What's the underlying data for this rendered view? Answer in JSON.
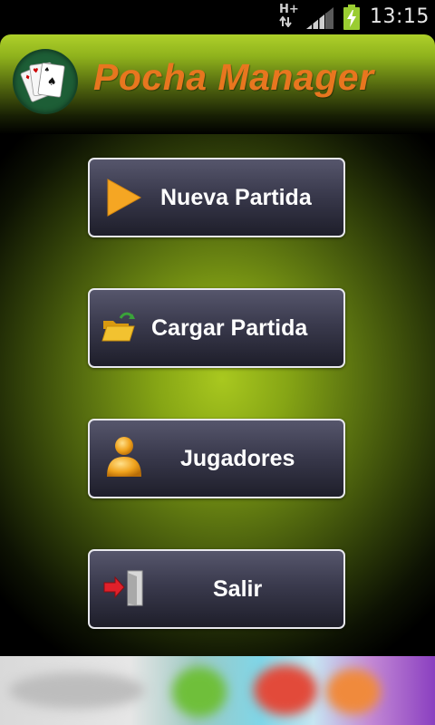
{
  "status_bar": {
    "network_type": "H+",
    "time": "13:15"
  },
  "header": {
    "title": "Pocha Manager",
    "logo_icon": "playing-cards-icon"
  },
  "menu": {
    "new_game": {
      "label": "Nueva Partida",
      "icon": "play-icon"
    },
    "load_game": {
      "label": "Cargar Partida",
      "icon": "folder-open-icon"
    },
    "players": {
      "label": "Jugadores",
      "icon": "user-icon"
    },
    "exit": {
      "label": "Salir",
      "icon": "exit-door-icon"
    }
  },
  "colors": {
    "title": "#e8761f",
    "accent_green": "#a9c81f",
    "button_bg": "#3a3a4d",
    "button_border": "#e8e8ee"
  }
}
